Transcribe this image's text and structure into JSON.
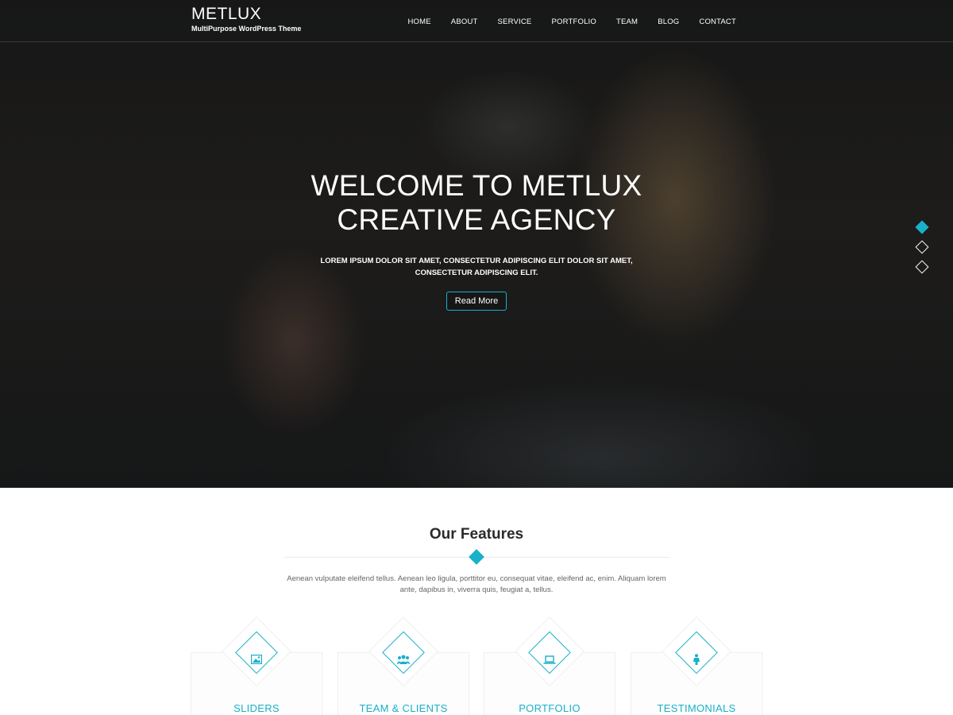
{
  "header": {
    "brand_title": "METLUX",
    "brand_tagline": "MultiPurpose WordPress Theme",
    "nav": [
      "HOME",
      "ABOUT",
      "SERVICE",
      "PORTFOLIO",
      "TEAM",
      "BLOG",
      "CONTACT"
    ]
  },
  "hero": {
    "title_line1": "WELCOME TO METLUX",
    "title_line2": "CREATIVE AGENCY",
    "text": "LOREM IPSUM DOLOR SIT AMET, CONSECTETUR ADIPISCING ELIT DOLOR SIT AMET, CONSECTETUR ADIPISCING ELIT.",
    "button_label": "Read More",
    "slides": {
      "count": 3,
      "active_index": 0
    }
  },
  "features": {
    "title": "Our Features",
    "description": "Aenean vulputate eleifend tellus. Aenean leo ligula, porttitor eu, consequat vitae, eleifend ac, enim. Aliquam lorem ante, dapibus in, viverra quis, feugiat a, tellus.",
    "cards": [
      {
        "title": "SLIDERS",
        "icon": "image-icon"
      },
      {
        "title": "TEAM & CLIENTS",
        "icon": "users-icon"
      },
      {
        "title": "PORTFOLIO",
        "icon": "laptop-icon"
      },
      {
        "title": "TESTIMONIALS",
        "icon": "person-icon"
      }
    ]
  },
  "colors": {
    "accent": "#19b0c9",
    "hero_overlay": "#1c1b1b",
    "text_muted": "#666666"
  }
}
